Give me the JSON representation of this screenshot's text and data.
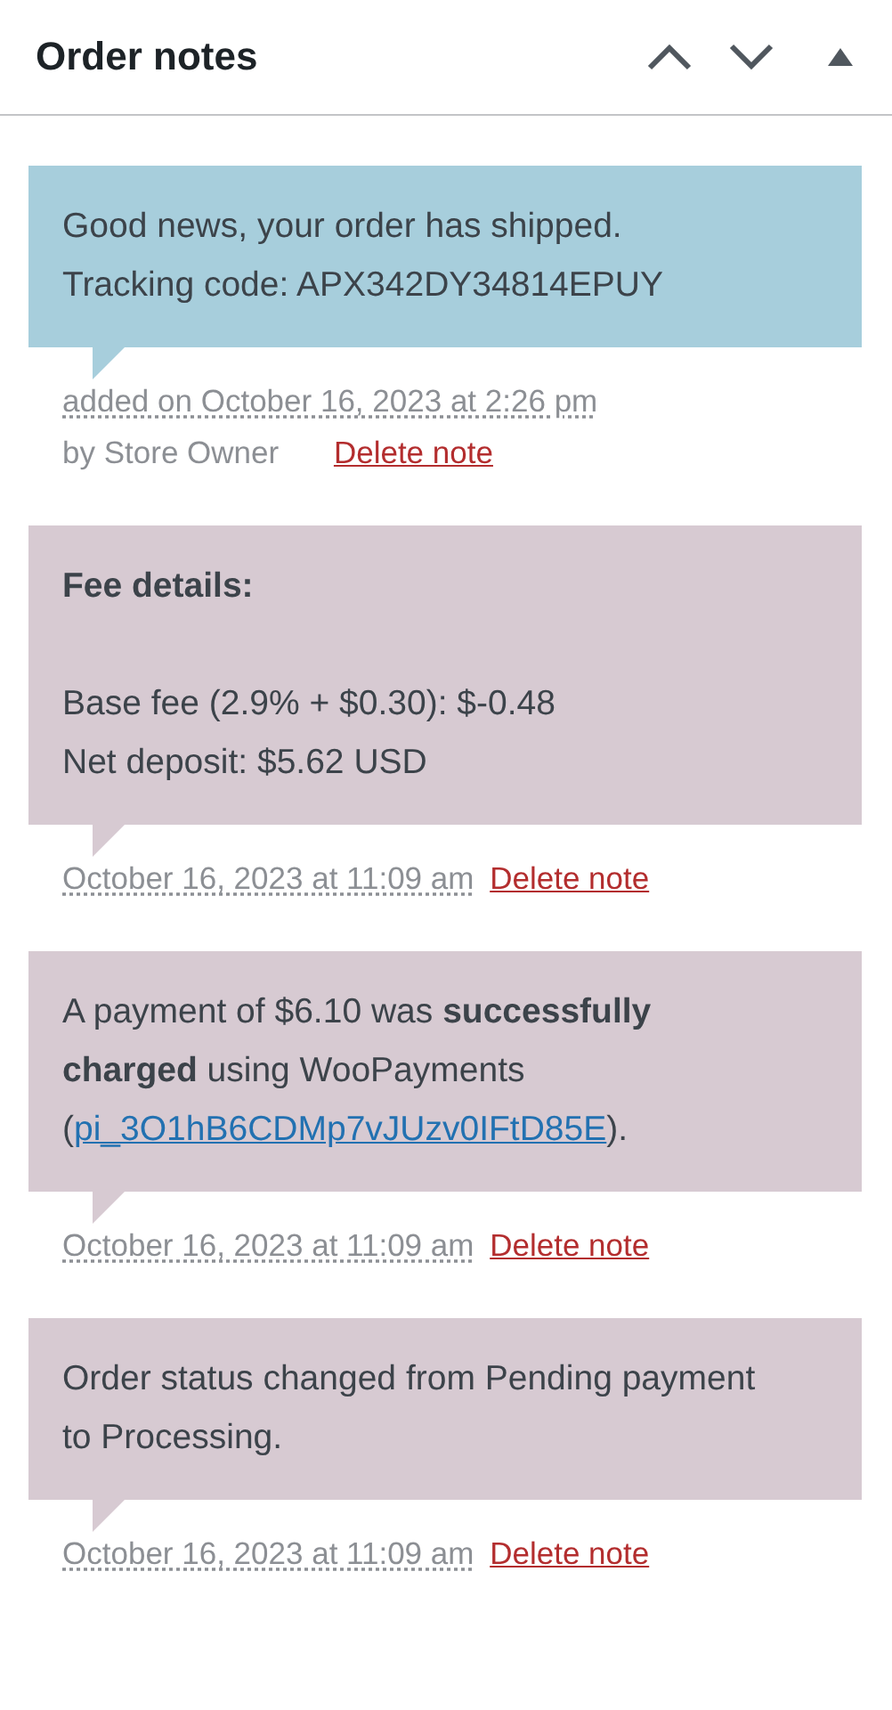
{
  "panel": {
    "title": "Order notes"
  },
  "notes": [
    {
      "kind": "customer",
      "paragraphs": [
        {
          "lines": [
            "Good news, your order has shipped.",
            "Tracking code: APX342DY34814EPUY"
          ]
        }
      ],
      "date": "added on October 16, 2023 at 2:26 pm",
      "author": "by Store Owner",
      "delete_label": "Delete note"
    },
    {
      "kind": "system",
      "paragraphs": [
        {
          "lines": [
            "Fee details:"
          ],
          "bold": true
        },
        {
          "lines": [
            "Base fee (2.9% + $0.30): $-0.48",
            "Net deposit: $5.62 USD"
          ]
        }
      ],
      "date": "October 16, 2023 at 11:09 am",
      "delete_label": "Delete note"
    },
    {
      "kind": "system",
      "paragraphs": [
        {
          "text": "A payment of $6.10 was **successfully charged** using WooPayments (",
          "link": "pi_3O1hB6CDMp7vJUzv0IFtD85E",
          "after": ")."
        }
      ],
      "date": "October 16, 2023 at 11:09 am",
      "delete_label": "Delete note"
    },
    {
      "kind": "system",
      "paragraphs": [
        {
          "lines": [
            "Order status changed from Pending payment to Processing."
          ]
        }
      ],
      "date": "October 16, 2023 at 11:09 am",
      "delete_label": "Delete note"
    }
  ]
}
